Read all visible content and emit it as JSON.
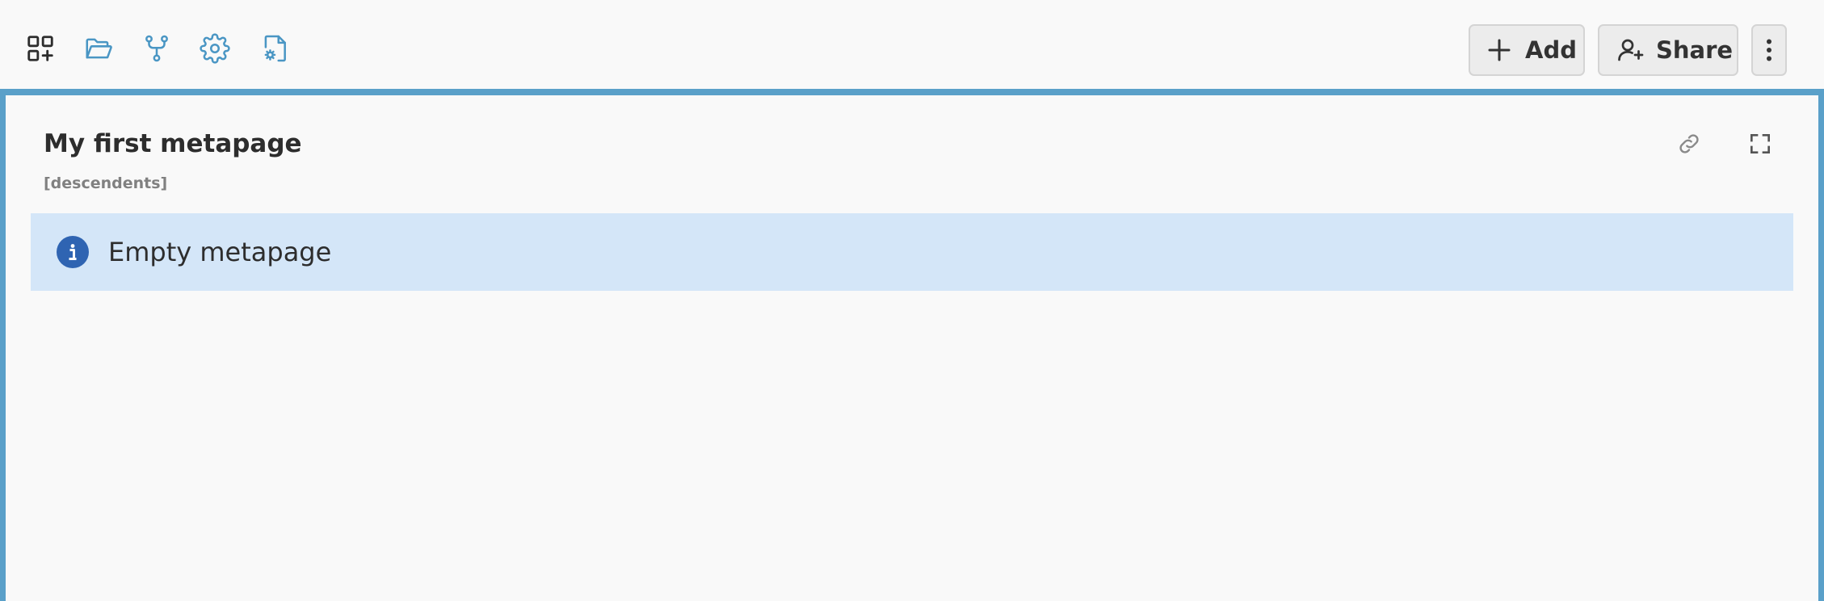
{
  "toolbar": {
    "icons": [
      {
        "name": "app-grid-add-icon"
      },
      {
        "name": "folder-open-icon"
      },
      {
        "name": "git-fork-icon"
      },
      {
        "name": "gear-icon"
      },
      {
        "name": "file-settings-icon"
      }
    ],
    "add_label": "Add",
    "share_label": "Share"
  },
  "metapage": {
    "title": "My first metapage",
    "subtitle": "[descendents]",
    "info_message": "Empty metapage"
  },
  "colors": {
    "accent": "#5aa0c9",
    "info_bg": "#d4e6f8",
    "info_icon": "#2f64b2",
    "background": "#f9f9f9"
  }
}
